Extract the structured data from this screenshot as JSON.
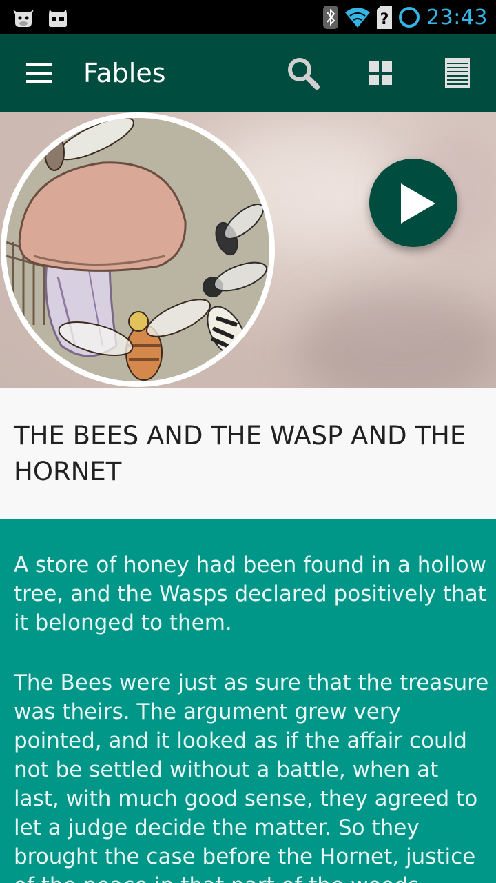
{
  "status_bar": {
    "time": "23:43",
    "left_icons": [
      "cow-notification-icon",
      "android-notification-icon"
    ],
    "right_icons": [
      "bluetooth-icon",
      "wifi-icon",
      "sim-unknown-icon",
      "sync-ring-icon"
    ]
  },
  "toolbar": {
    "title": "Fables",
    "menu_icon": "hamburger-menu-icon",
    "actions": [
      "search-icon",
      "grid-view-icon",
      "list-view-icon"
    ]
  },
  "hero": {
    "image": "illustration-bees-wasp-hornet-mushroom",
    "play_icon": "play-icon"
  },
  "story": {
    "title": "THE BEES AND THE WASP AND THE HORNET",
    "paragraphs": [
      "A store of honey had been found in a hollow tree, and the Wasps declared positively that it belonged to them.",
      "The Bees were just as sure that the treasure was theirs. The argument grew very pointed, and it looked as if the affair could not be settled without a battle, when at last, with much good sense, they agreed to let a judge decide the matter. So they brought the case before the Hornet, justice of the peace in that part of the woods."
    ]
  },
  "colors": {
    "toolbar": "#004d40",
    "content_bg": "#009688",
    "status_accent": "#33b5e5"
  }
}
